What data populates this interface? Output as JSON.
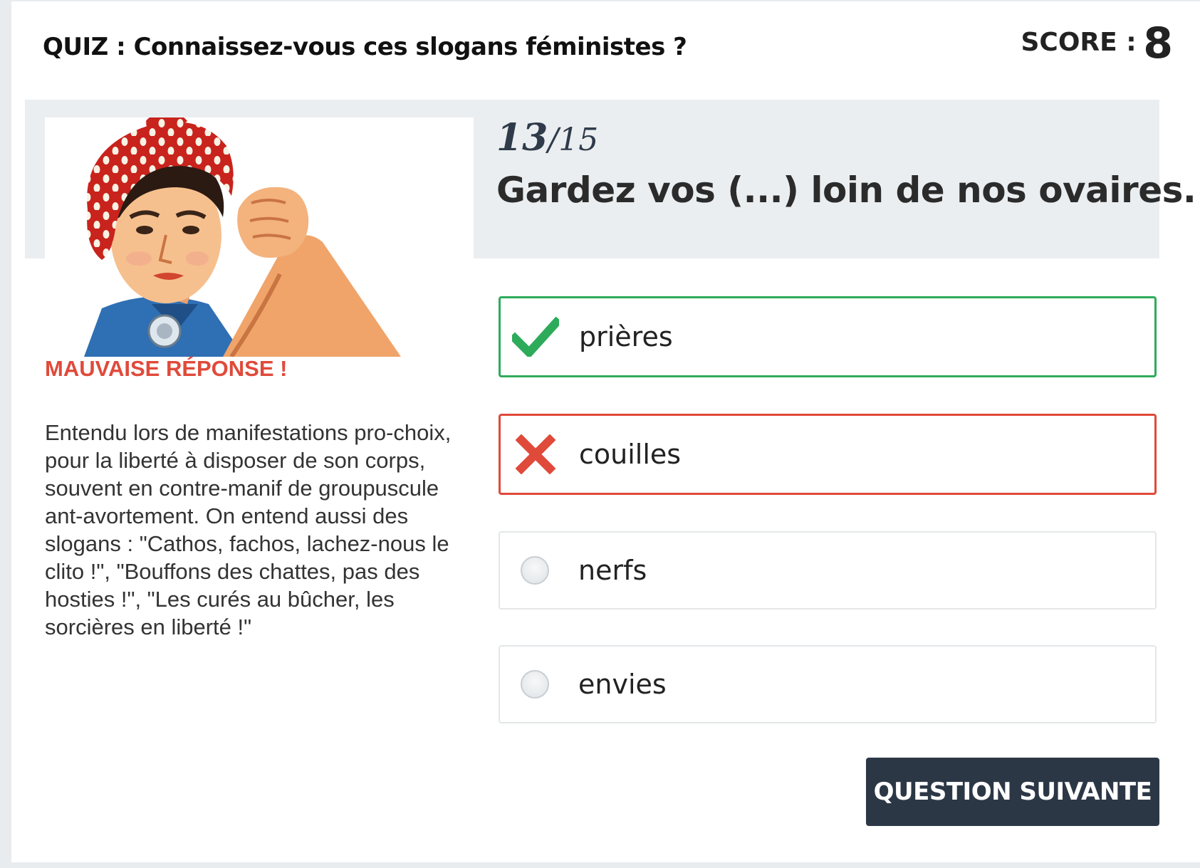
{
  "quiz": {
    "title": "QUIZ : Connaissez-vous ces slogans féministes ?",
    "score_label": "SCORE :",
    "score_value": "8"
  },
  "question": {
    "current": "13",
    "separator": "/",
    "total": "15",
    "text": "Gardez vos (...) loin de nos ovaires."
  },
  "feedback": {
    "verdict": "MAUVAISE RÉPONSE !",
    "explanation": "Entendu lors de manifestations pro-choix, pour la liberté à disposer de son corps, souvent en contre-manif de groupuscule ant-avortement. On entend aussi des slogans : \"Cathos, fachos, lachez-nous le clito !\", \"Bouffons des chattes, pas des hosties !\", \"Les curés au bûcher, les sorcières en liberté !\""
  },
  "answers": [
    {
      "label": "prières",
      "state": "correct",
      "icon": "check-icon"
    },
    {
      "label": "couilles",
      "state": "wrong",
      "icon": "cross-icon"
    },
    {
      "label": "nerfs",
      "state": "unselected",
      "icon": "radio-icon"
    },
    {
      "label": "envies",
      "state": "unselected",
      "icon": "radio-icon"
    }
  ],
  "next_button": {
    "label": "QUESTION SUIVANTE"
  },
  "colors": {
    "correct": "#2eab5a",
    "wrong": "#e04a3a",
    "button": "#2c3746",
    "band": "#ebeef0"
  }
}
